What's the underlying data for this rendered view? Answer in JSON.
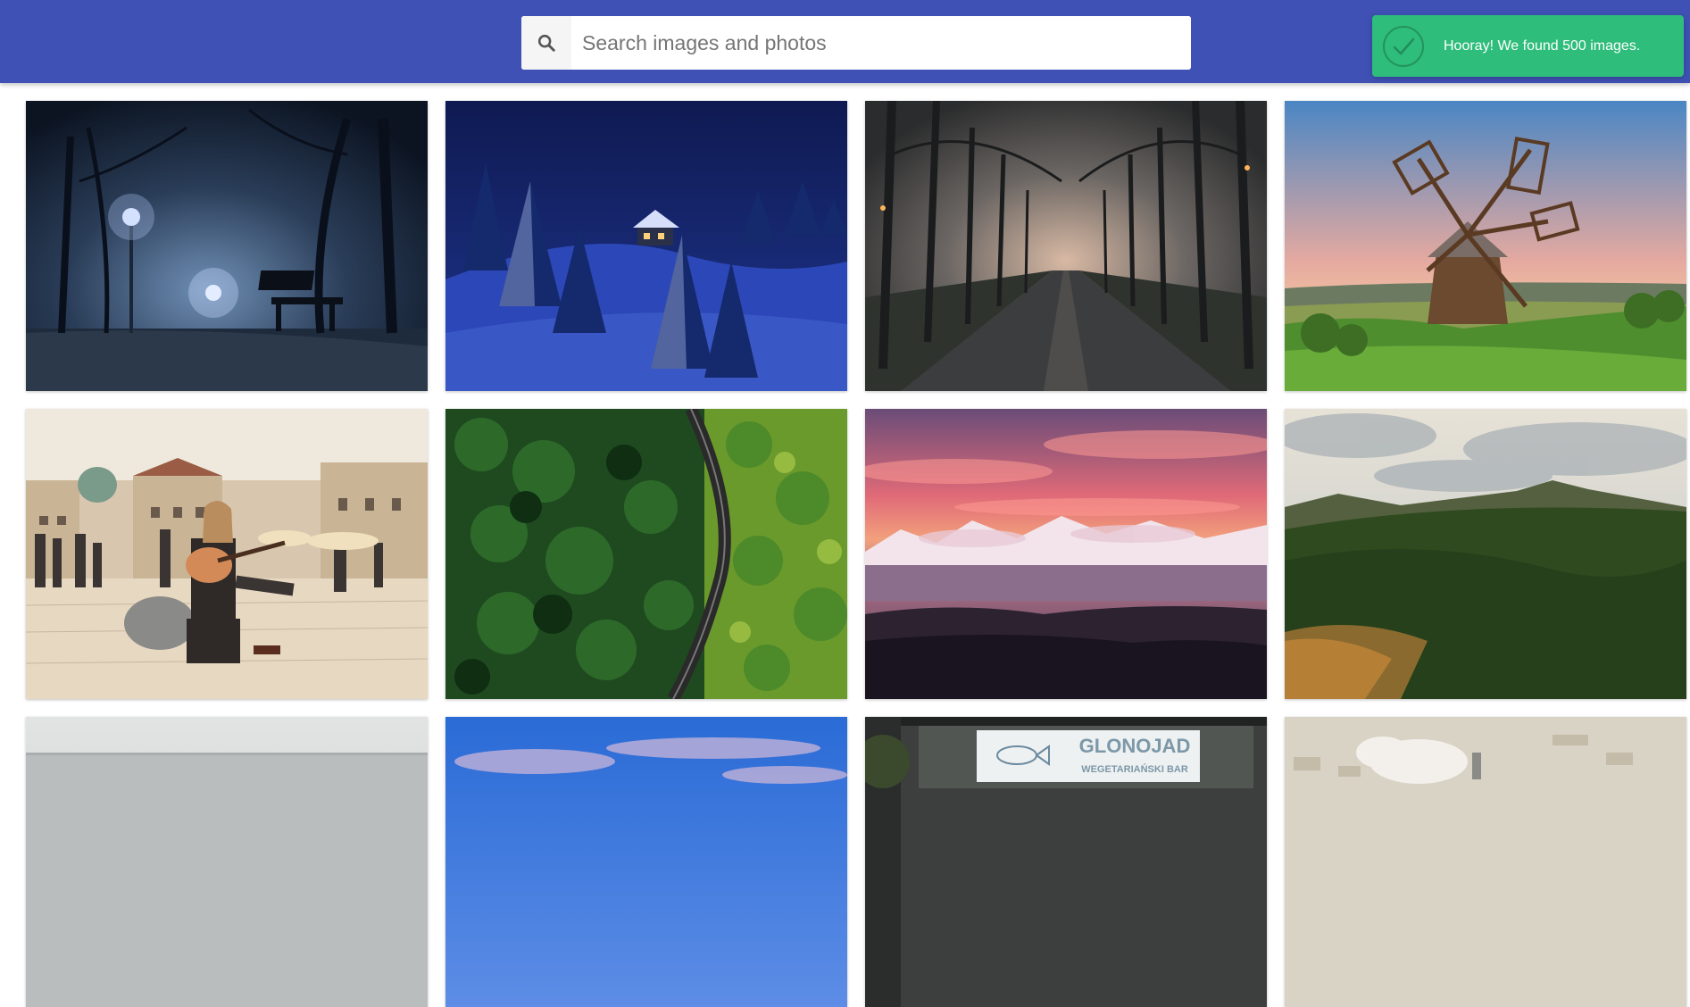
{
  "header": {
    "background_color": "#3f51b5",
    "search": {
      "placeholder": "Search images and photos",
      "value": "",
      "button_icon": "search-icon"
    }
  },
  "toast": {
    "message": "Hooray! We found 500 images.",
    "icon": "check-circle-icon",
    "background_color": "#2ebd7a"
  },
  "gallery": {
    "items": [
      {
        "scene": "foggy-night-park-bench"
      },
      {
        "scene": "snowy-forest-cabin-night"
      },
      {
        "scene": "misty-tree-alley-road"
      },
      {
        "scene": "wooden-windmill-sunset"
      },
      {
        "scene": "street-guitarist-town-square"
      },
      {
        "scene": "aerial-forest-railway"
      },
      {
        "scene": "pink-sunset-mountains"
      },
      {
        "scene": "green-forested-hills"
      },
      {
        "scene": "misty-sea-horizon"
      },
      {
        "scene": "blue-sky-clouds"
      },
      {
        "scene": "storefront-sign",
        "sign_text": [
          "GLONOJAD",
          "WEGETARIAŃSKI BAR"
        ]
      },
      {
        "scene": "hazy-aerial-town"
      }
    ]
  }
}
